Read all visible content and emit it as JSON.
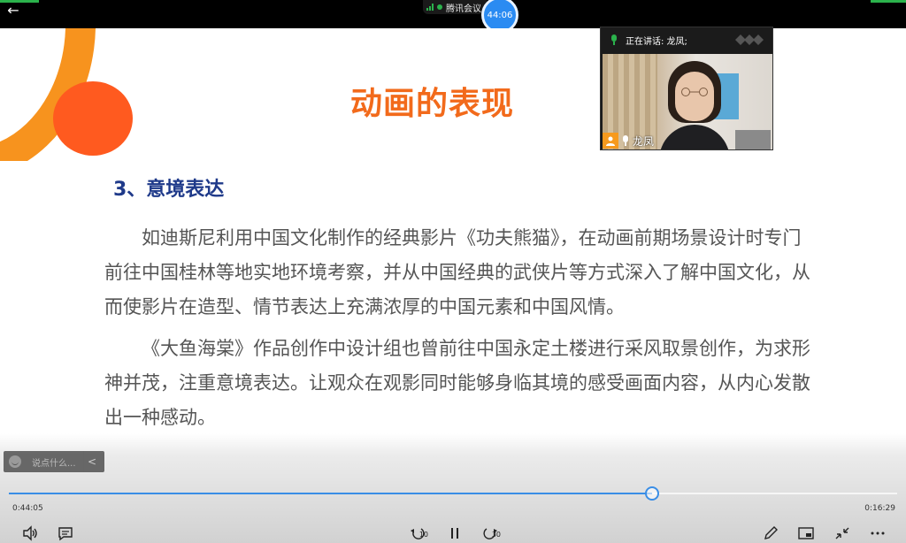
{
  "topbar": {
    "app_name": "腾讯会议",
    "timer": "44:06"
  },
  "slide": {
    "title": "动画的表现",
    "section": "3、意境表达",
    "para1": "如迪斯尼利用中国文化制作的经典影片《功夫熊猫》，在动画前期场景设计时专门前往中国桂林等地实地环境考察，并从中国经典的武侠片等方式深入了解中国文化，从而使影片在造型、情节表达上充满浓厚的中国元素和中国风情。",
    "para2": "《大鱼海棠》作品创作中设计组也曾前往中国永定土楼进行采风取景创作，为求形神并茂，注重意境表达。让观众在观影同时能够身临其境的感受画面内容，从内心发散出一种感动。"
  },
  "speaker": {
    "speaking_label": "正在讲话: 龙凤;",
    "name": "龙凤"
  },
  "controls": {
    "comment_placeholder": "说点什么...",
    "current_time": "0:44:05",
    "total_time": "0:16:29",
    "progress": 0.724,
    "rewind_label": "10",
    "forward_label": "30"
  },
  "colors": {
    "title": "#f26a1b",
    "section": "#1f3a8a",
    "accent": "#3a8ee6",
    "meeting_green": "#2bb24c"
  }
}
